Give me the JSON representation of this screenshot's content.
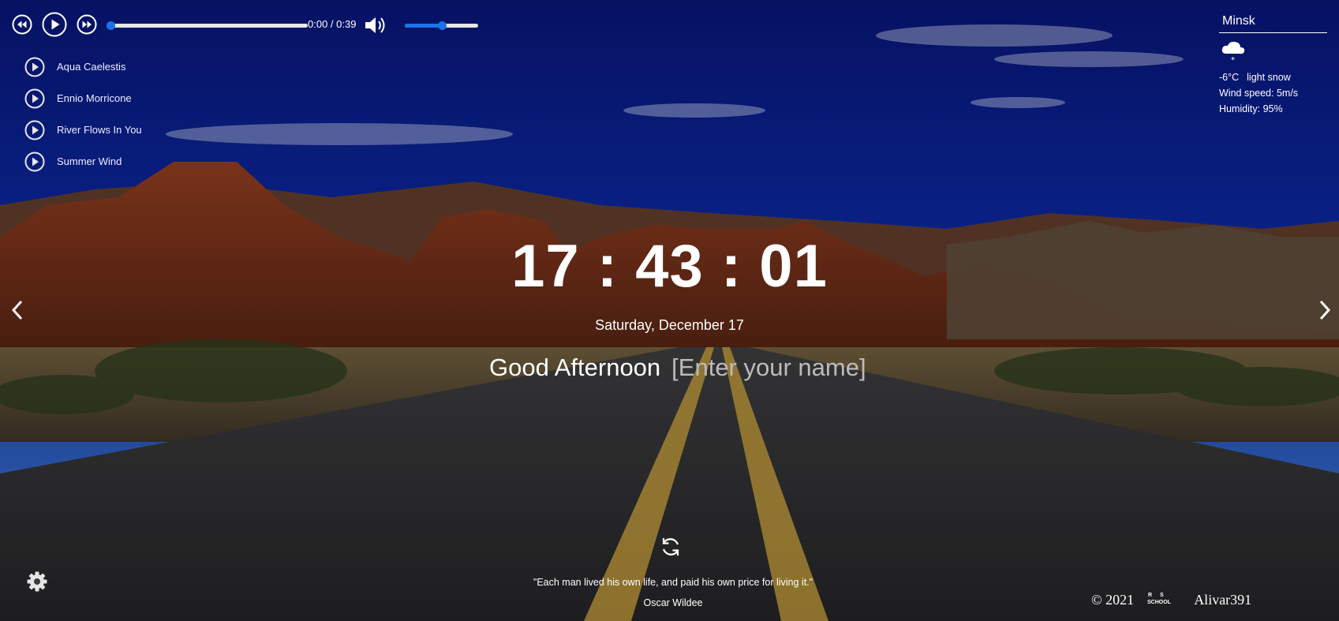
{
  "player": {
    "time": "0:00 / 0:39",
    "progress_fraction": 0,
    "volume_fraction": 0.5,
    "playlist": [
      {
        "title": "Aqua Caelestis"
      },
      {
        "title": "Ennio Morricone"
      },
      {
        "title": "River Flows In You"
      },
      {
        "title": "Summer Wind"
      }
    ]
  },
  "weather": {
    "city": "Minsk",
    "icon": "snow-cloud-icon",
    "temperature": "-6°C",
    "description": "light snow",
    "wind": "Wind speed: 5m/s",
    "humidity": "Humidity: 95%"
  },
  "clock": {
    "time": "17 : 43 : 01"
  },
  "date": "Saturday, December 17",
  "greeting": {
    "text": "Good Afternoon",
    "name_placeholder": "[Enter your name]",
    "name_value": ""
  },
  "quote": {
    "text": "\"Each man lived his own life, and paid his own price for living it.\"",
    "author": "Oscar Wildee"
  },
  "footer": {
    "copyright": "© 2021",
    "logo_text": "RS SCHOOL",
    "author": "Alivar391"
  },
  "colors": {
    "accent": "#1a73e8",
    "sky": "#0b1a6e",
    "text": "#ffffff"
  }
}
